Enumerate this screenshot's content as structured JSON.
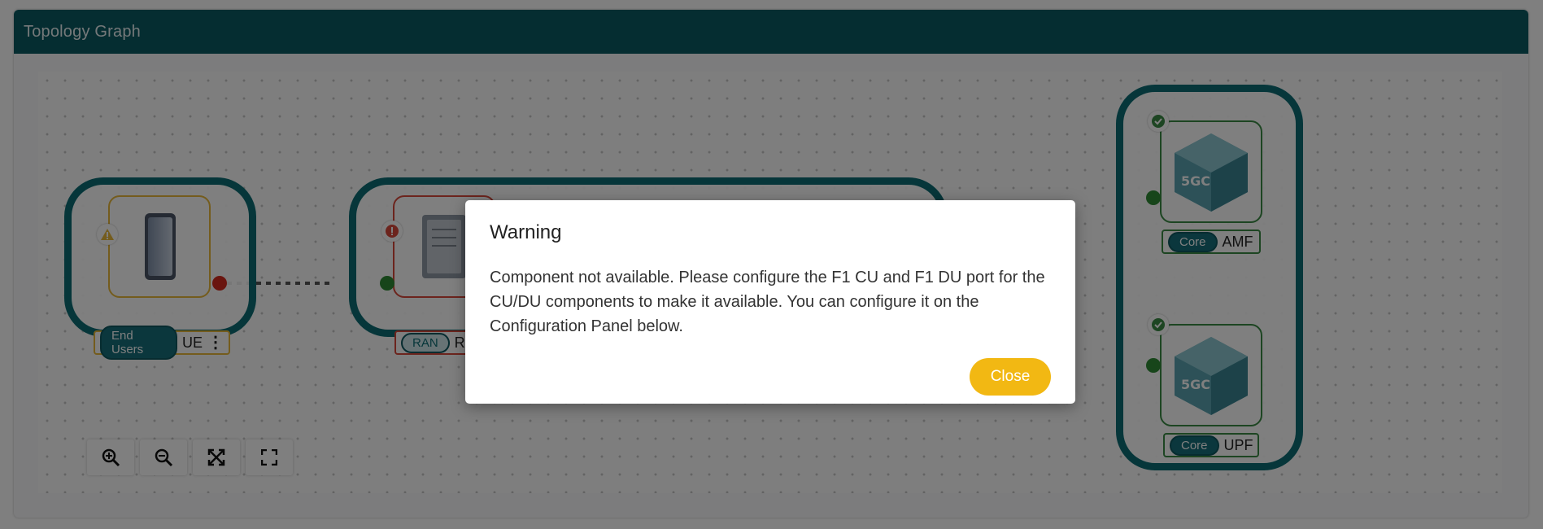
{
  "header": {
    "title": "Topology Graph"
  },
  "nodes": {
    "ue": {
      "category": "End Users",
      "name": "UE"
    },
    "ran": {
      "category": "RAN",
      "name": "R"
    },
    "amf": {
      "category": "Core",
      "name": "AMF"
    },
    "upf": {
      "category": "Core",
      "name": "UPF"
    }
  },
  "toolbar": {
    "zoom_in_icon": "zoom-in-icon",
    "zoom_out_icon": "zoom-out-icon",
    "fit_icon": "fit-view-icon",
    "fullscreen_icon": "fullscreen-icon"
  },
  "modal": {
    "title": "Warning",
    "message": "Component not available. Please configure the F1 CU and F1 DU port for the CU/DU components to make it available. You can configure it on the Configuration Panel below.",
    "close_label": "Close"
  },
  "colors": {
    "header": "#0b5a63",
    "group_border": "#0c6d74",
    "warning": "#e9b83a",
    "error": "#d8483a",
    "ok": "#3a8a44",
    "close_button": "#f2b813"
  }
}
